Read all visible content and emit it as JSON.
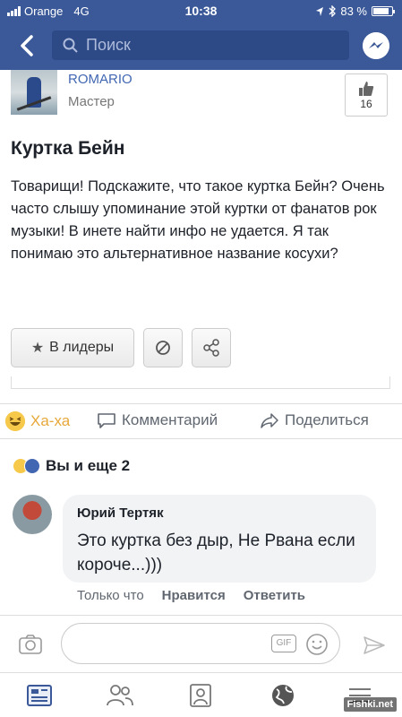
{
  "status_bar": {
    "carrier": "Orange",
    "network": "4G",
    "time": "10:38",
    "battery": "83 %"
  },
  "nav": {
    "search_placeholder": "Поиск"
  },
  "post": {
    "author": "ROMARIO",
    "rank": "Мастер",
    "likes": "16",
    "title": "Куртка Бейн",
    "body": "Товарищи! Подскажите, что такое куртка Бейн? Очень часто слышу упоминание этой куртки от фанатов рок музыки! В инете найти инфо не удается. Я так понимаю это альтернативное название косухи?",
    "leaders_label": "В лидеры"
  },
  "reactions": {
    "haha_label": "Ха-ха",
    "comment_label": "Комментарий",
    "share_label": "Поделиться",
    "likers_text": "Вы и еще 2"
  },
  "comment": {
    "author": "Юрий Тертяк",
    "text": "Это куртка без дыр, Не Рвана если короче...)))",
    "time": "Только что",
    "like_label": "Нравится",
    "reply_label": "Ответить"
  },
  "composer": {
    "gif_label": "GIF"
  },
  "watermark": "Fishki.net",
  "colors": {
    "brand": "#3b5998",
    "link": "#4267b2",
    "haha": "#e7a83a"
  }
}
